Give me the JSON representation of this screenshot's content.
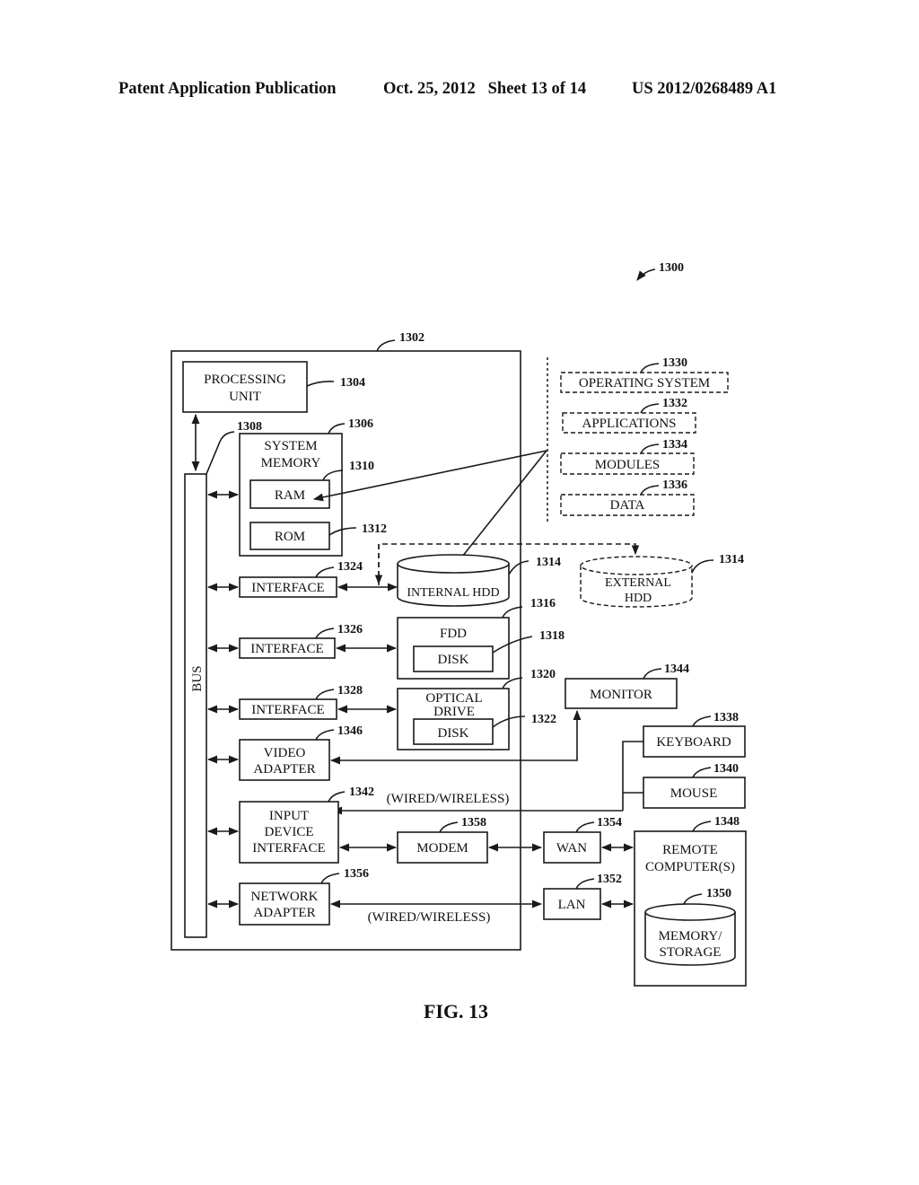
{
  "header": {
    "publication": "Patent Application Publication",
    "date_sheet": "Oct. 25, 2012   Sheet 13 of 14",
    "number": "US 2012/0268489 A1"
  },
  "figure": {
    "caption": "FIG. 13",
    "ref_system": "1300",
    "computer": {
      "ref": "1302"
    },
    "processing_unit": {
      "lines": [
        "PROCESSING",
        "UNIT"
      ],
      "ref": "1304"
    },
    "bus": {
      "label": "BUS",
      "ref": "1308"
    },
    "system_memory": {
      "lines": [
        "SYSTEM",
        "MEMORY"
      ],
      "ref": "1306"
    },
    "ram": {
      "label": "RAM",
      "ref": "1310"
    },
    "rom": {
      "label": "ROM",
      "ref": "1312"
    },
    "interface_hdd": {
      "label": "INTERFACE",
      "ref": "1324"
    },
    "interface_fdd": {
      "label": "INTERFACE",
      "ref": "1326"
    },
    "interface_optical": {
      "label": "INTERFACE",
      "ref": "1328"
    },
    "internal_hdd": {
      "label": "INTERNAL HDD",
      "ref": "1314"
    },
    "external_hdd": {
      "lines": [
        "EXTERNAL",
        "HDD"
      ],
      "ref": "1314"
    },
    "fdd": {
      "label": "FDD",
      "ref": "1316"
    },
    "fdd_disk": {
      "label": "DISK",
      "ref": "1318"
    },
    "optical_drive": {
      "lines": [
        "OPTICAL",
        "DRIVE"
      ],
      "ref": "1320"
    },
    "optical_disk": {
      "label": "DISK",
      "ref": "1322"
    },
    "video_adapter": {
      "lines": [
        "VIDEO",
        "ADAPTER"
      ],
      "ref": "1346"
    },
    "input_device_interface": {
      "lines": [
        "INPUT",
        "DEVICE",
        "INTERFACE"
      ],
      "ref": "1342"
    },
    "network_adapter": {
      "lines": [
        "NETWORK",
        "ADAPTER"
      ],
      "ref": "1356"
    },
    "modem": {
      "label": "MODEM",
      "ref": "1358"
    },
    "monitor": {
      "label": "MONITOR",
      "ref": "1344"
    },
    "keyboard": {
      "label": "KEYBOARD",
      "ref": "1338"
    },
    "mouse": {
      "label": "MOUSE",
      "ref": "1340"
    },
    "wan": {
      "label": "WAN",
      "ref": "1354"
    },
    "lan": {
      "label": "LAN",
      "ref": "1352"
    },
    "remote_computer": {
      "lines": [
        "REMOTE",
        "COMPUTER(S)"
      ],
      "ref": "1348"
    },
    "memory_storage": {
      "lines": [
        "MEMORY/",
        "STORAGE"
      ],
      "ref": "1350"
    },
    "software": {
      "operating_system": {
        "label": "OPERATING SYSTEM",
        "ref": "1330"
      },
      "applications": {
        "label": "APPLICATIONS",
        "ref": "1332"
      },
      "modules": {
        "label": "MODULES",
        "ref": "1334"
      },
      "data": {
        "label": "DATA",
        "ref": "1336"
      }
    },
    "wired_wireless_input": "(WIRED/WIRELESS)",
    "wired_wireless_network": "(WIRED/WIRELESS)"
  }
}
